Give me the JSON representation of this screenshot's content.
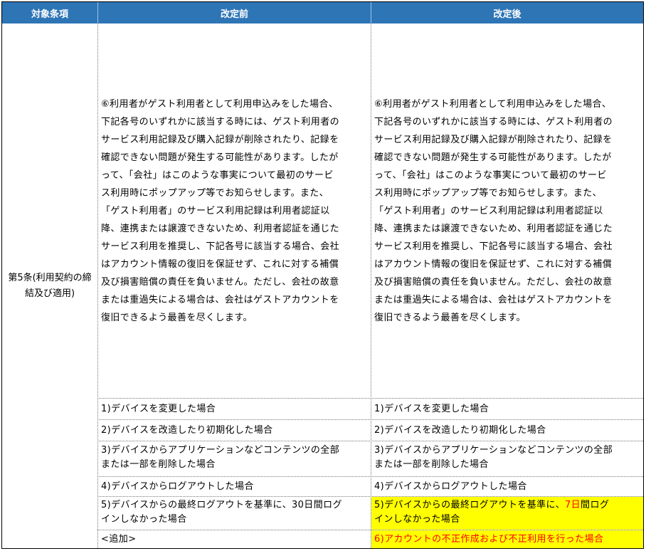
{
  "headers": {
    "target": "対象条項",
    "before": "改定前",
    "after": "改定後"
  },
  "target_clause": "第5条(利用契約の締結及び適用)",
  "main_paragraph": {
    "before_lines": [
      "⑥利用者がゲスト利用者として利用申込みをした場合、",
      "下記各号のいずれかに該当する時には、ゲスト利用者の",
      "サービス利用記録及び購入記録が削除されたり、記録を",
      "確認できない問題が発生する可能性があります。したが",
      "って、「会社」はこのような事実について最初のサービ",
      "ス利用時にポップアップ等でお知らせします。また、",
      "「ゲスト利用者」のサービス利用記録は利用者認証以",
      "降、連携または譲渡できないため、利用者認証を通じた",
      "サービス利用を推奨し、下記各号に該当する場合、会社",
      "はアカウント情報の復旧を保証せず、これに対する補償",
      "及び損害賠償の責任を負いません。ただし、会社の故意",
      "または重過失による場合は、会社はゲストアカウントを",
      "復旧できるよう最善を尽くします。"
    ],
    "after_lines": [
      "⑥利用者がゲスト利用者として利用申込みをした場合、",
      "下記各号のいずれかに該当する時には、ゲスト利用者の",
      "サービス利用記録及び購入記録が削除されたり、記録を",
      "確認できない問題が発生する可能性があります。したが",
      "って、「会社」はこのような事実について最初のサービ",
      "ス利用時にポップアップ等でお知らせします。また、",
      "「ゲスト利用者」のサービス利用記録は利用者認証以",
      "降、連携または譲渡できないため、利用者認証を通じた",
      "サービス利用を推奨し、下記各号に該当する場合、会社",
      "はアカウント情報の復旧を保証せず、これに対する補償",
      "及び損害賠償の責任を負いません。ただし、会社の故意",
      "または重過失による場合は、会社はゲストアカウントを",
      "復旧できるよう最善を尽くします。"
    ]
  },
  "items": {
    "i1_before": "1)デバイスを変更した場合",
    "i1_after": "1)デバイスを変更した場合",
    "i2_before": "2)デバイスを改造したり初期化した場合",
    "i2_after": "2)デバイスを改造したり初期化した場合",
    "i3_before_l1": "3)デバイスからアプリケーションなどコンテンツの全部",
    "i3_before_l2": "または一部を削除した場合",
    "i3_after_l1": "3)デバイスからアプリケーションなどコンテンツの全部",
    "i3_after_l2": "または一部を削除した場合",
    "i4_before": "4)デバイスからログアウトした場合",
    "i4_after": "4)デバイスからログアウトした場合",
    "i5_before_l1": "5)デバイスからの最終ログアウトを基準に、30日間ログ",
    "i5_before_l2": "インしなかった場合",
    "i5_after_pre": "5)デバイスからの最終ログアウトを基準に、",
    "i5_after_changed": "7日",
    "i5_after_post": "間ログ",
    "i5_after_l2": "インしなかった場合",
    "i6_before": "<追加>",
    "i6_after": "6)アカウントの不正作成および不正利用を行った場合"
  },
  "colors": {
    "header_bg": "#2e75b6",
    "highlight_bg": "#ffff00",
    "changed_text": "#ff0000"
  }
}
